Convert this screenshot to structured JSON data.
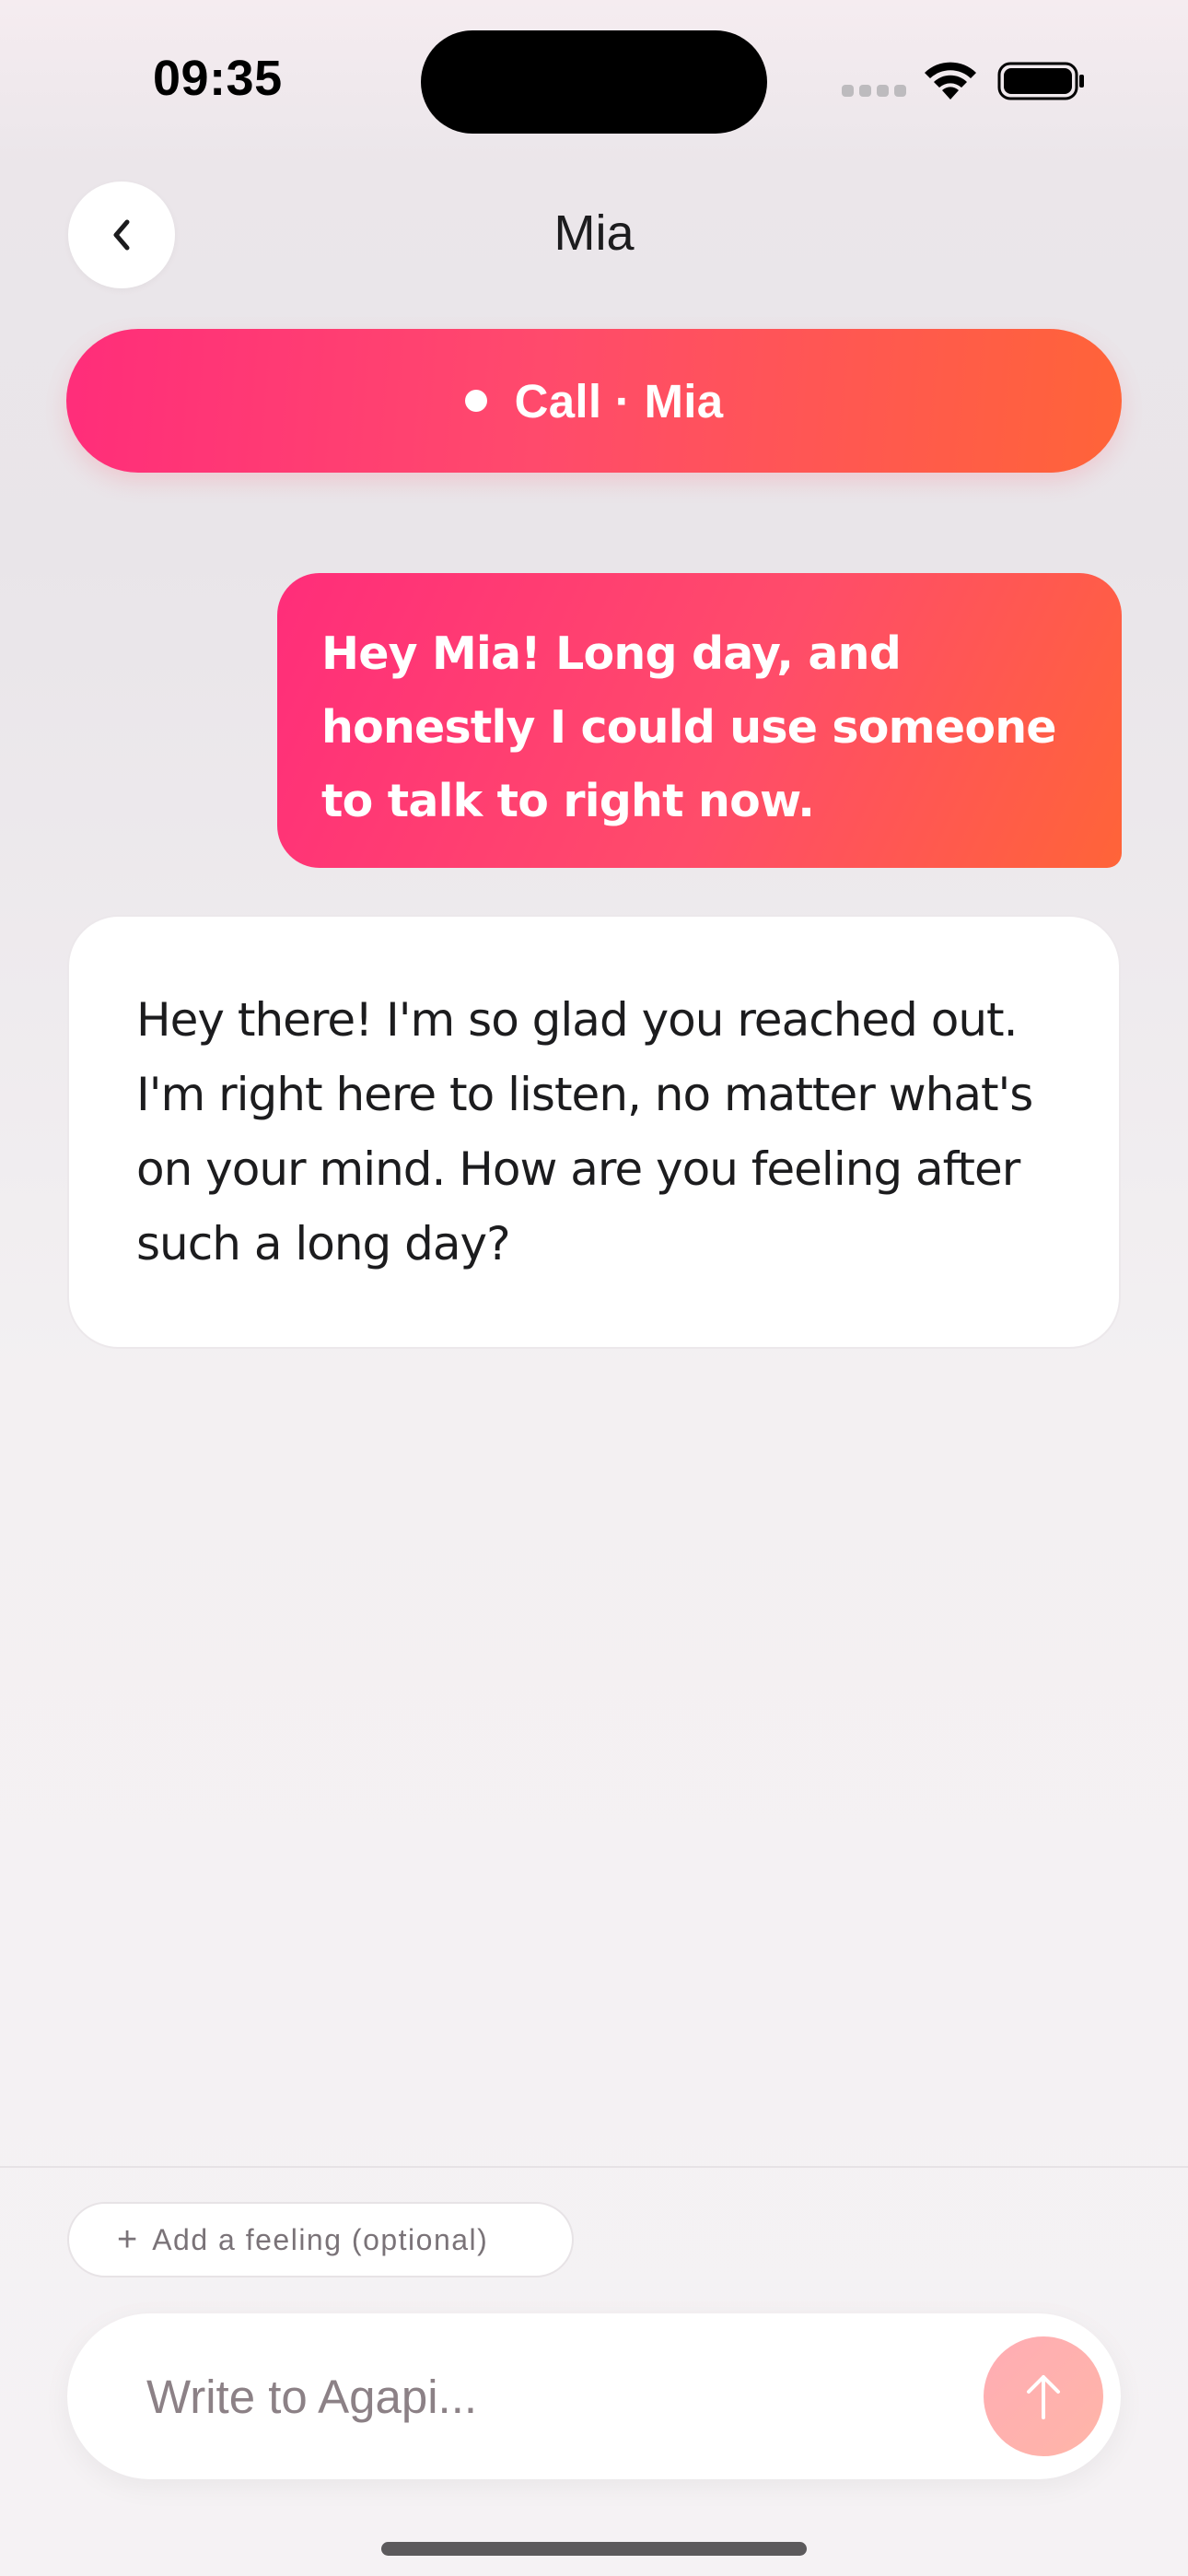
{
  "status_bar": {
    "time": "09:35",
    "icons": [
      "signal-icon",
      "wifi-icon",
      "battery-icon"
    ]
  },
  "header": {
    "back_icon": "chevron-left-icon",
    "title": "Mia"
  },
  "call_banner": {
    "label": "Call · Mia",
    "gradient": [
      "#ff2d7a",
      "#ff6438"
    ]
  },
  "messages": [
    {
      "sender": "user",
      "text": "Hey Mia! Long day, and honestly I could use someone to talk to right now."
    },
    {
      "sender": "assistant",
      "text": "Hey there! I'm so glad you reached out. I'm right here to listen, no matter what's on your mind. How are you feeling after such a long day?"
    }
  ],
  "composer": {
    "feeling_label": "Add a feeling (optional)",
    "input_placeholder": "Write to Agapi...",
    "input_value": "",
    "send_icon": "arrow-up-icon"
  },
  "colors": {
    "accent_pink": "#ff2d7a",
    "accent_orange": "#ff6438",
    "send_button": "#ffadb4"
  }
}
